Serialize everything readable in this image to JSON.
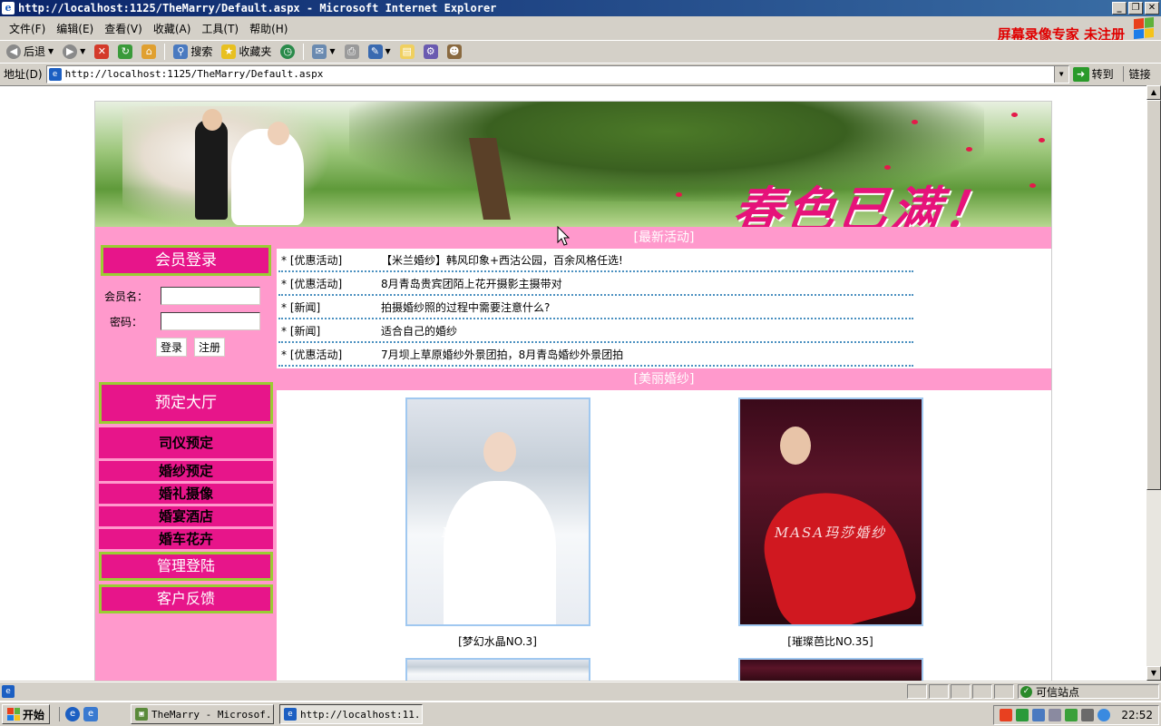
{
  "window": {
    "title": "http://localhost:1125/TheMarry/Default.aspx - Microsoft Internet Explorer",
    "min_label": "_",
    "max_label": "❐",
    "close_label": "✕"
  },
  "menu": [
    "文件(F)",
    "编辑(E)",
    "查看(V)",
    "收藏(A)",
    "工具(T)",
    "帮助(H)"
  ],
  "watermark": "屏幕录像专家  未注册",
  "toolbar": {
    "back": "后退",
    "search": "搜索",
    "favorites": "收藏夹"
  },
  "address": {
    "label": "地址(D)",
    "url": "http://localhost:1125/TheMarry/Default.aspx",
    "go": "转到",
    "links": "链接"
  },
  "page": {
    "banner_slogan": "春色已满！",
    "login": {
      "title": "会员登录",
      "username_label": "会员名：",
      "password_label": "密码：",
      "login_button": "登录",
      "register_button": "注册"
    },
    "nav": {
      "reserve_hall": "预定大厅",
      "items": [
        "司仪预定",
        "婚纱预定",
        "婚礼摄像",
        "婚宴酒店",
        "婚车花卉"
      ],
      "admin_login": "管理登陆",
      "feedback": "客户反馈"
    },
    "news": {
      "title": "[最新活动]",
      "rows": [
        {
          "cat": "* [优惠活动]",
          "text": "【米兰婚纱】韩风印象+西沽公园，百余风格任选!"
        },
        {
          "cat": "* [优惠活动]",
          "text": "8月青岛贵宾团陌上花开摄影主摄带对"
        },
        {
          "cat": "* [新闻]",
          "text": "拍摄婚纱照的过程中需要注意什么?"
        },
        {
          "cat": "* [新闻]",
          "text": "适合自己的婚纱"
        },
        {
          "cat": "* [优惠活动]",
          "text": "7月坝上草原婚纱外景团拍，8月青岛婚纱外景团拍"
        }
      ]
    },
    "gallery": {
      "title": "[美丽婚纱]",
      "watermark": "MASA玛莎婚纱",
      "photos": [
        {
          "caption": "[梦幻水晶NO.3]"
        },
        {
          "caption": "[璀璨芭比NO.35]"
        }
      ]
    }
  },
  "status": {
    "zone": "可信站点"
  },
  "taskbar": {
    "start": "开始",
    "tasks": [
      "TheMarry - Microsof...",
      "http://localhost:11..."
    ],
    "clock": "22:52"
  }
}
